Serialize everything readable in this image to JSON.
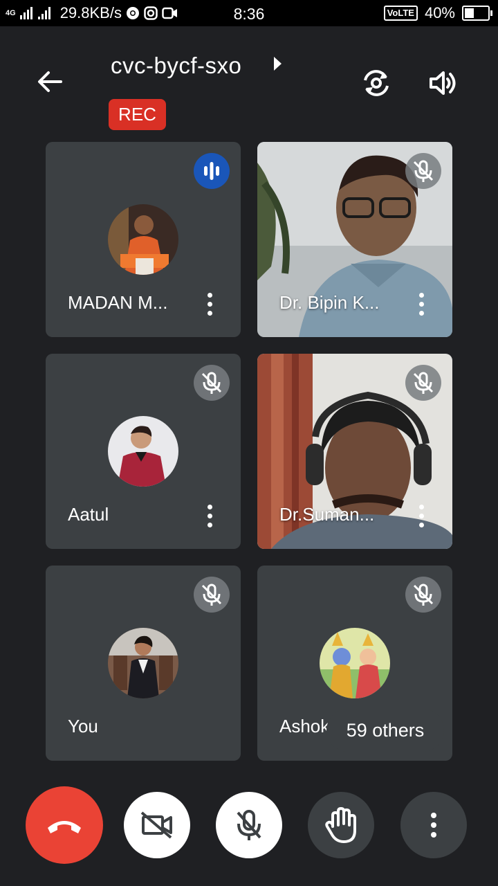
{
  "status_bar": {
    "network_type": "4G",
    "speed": "29.8KB/s",
    "time": "8:36",
    "volte": "VoLTE",
    "battery_percent": "40%",
    "battery_level": 0.4
  },
  "meeting": {
    "code": "cvc-bycf-sxo",
    "recording_badge": "REC"
  },
  "participants": [
    {
      "name": "MADAN M...",
      "muted": false,
      "speaking": true,
      "video": false
    },
    {
      "name": "Dr. Bipin K...",
      "muted": true,
      "video": true
    },
    {
      "name": "Aatul",
      "muted": true,
      "video": false
    },
    {
      "name": "Dr.Suman...",
      "muted": true,
      "video": true
    },
    {
      "name": "You",
      "muted": true,
      "video": false
    },
    {
      "name": "Ashok",
      "muted": true,
      "video": false
    }
  ],
  "others_count_label": "59 others",
  "icons": {
    "back": "arrow-left-icon",
    "switch_camera": "camera-switch-icon",
    "speaker": "speaker-icon",
    "end_call": "phone-hangup-icon",
    "camera_off": "video-off-icon",
    "mic_off": "mic-off-icon",
    "raise_hand": "hand-icon",
    "more": "more-vert-icon"
  },
  "colors": {
    "background": "#1f2023",
    "tile": "#3c4043",
    "rec": "#d93025",
    "end_call": "#ea4335",
    "speaking": "#1a56b9"
  }
}
